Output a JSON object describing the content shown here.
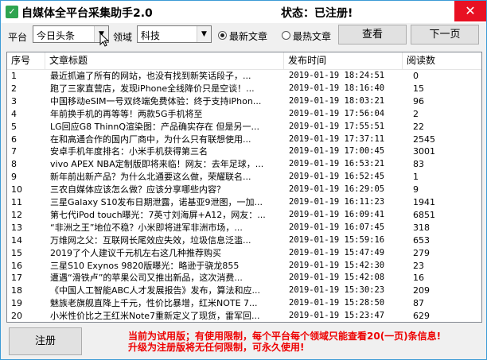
{
  "window": {
    "title": "自媒体全平台采集助手2.0",
    "status": "状态：已注册!",
    "icon": "app-logo-icon"
  },
  "toolbar": {
    "platform_label": "平台",
    "platform_value": "今日头条",
    "domain_label": "领域",
    "domain_value": "科技",
    "radio_latest": "最新文章",
    "radio_hottest": "最热文章",
    "selected_radio": "latest",
    "view_button": "查看",
    "next_button": "下一页"
  },
  "table": {
    "headers": {
      "no": "序号",
      "title": "文章标题",
      "date": "发布时间",
      "reads": "阅读数"
    },
    "rows": [
      {
        "no": "1",
        "title": "最近抓遍了所有的网站，也没有找到新笑话段子，...",
        "date": "2019-01-19 18:24:51",
        "reads": "0"
      },
      {
        "no": "2",
        "title": "跑了三家直营店，发现iPhone全线降价只是空谈！...",
        "date": "2019-01-19 18:16:40",
        "reads": "15"
      },
      {
        "no": "3",
        "title": "中国移动eSIM一号双终端免费体验：终于支持iPhon...",
        "date": "2019-01-19 18:03:21",
        "reads": "96"
      },
      {
        "no": "4",
        "title": "年前换手机的再等等！两款5G手机将至",
        "date": "2019-01-19 17:56:04",
        "reads": "2"
      },
      {
        "no": "5",
        "title": "LG回应G8 ThinnQ渲染图：产品确实存在 但是另一...",
        "date": "2019-01-19 17:55:51",
        "reads": "22"
      },
      {
        "no": "6",
        "title": "在和高通合作的国内厂商中，为什么只有联想使用...",
        "date": "2019-01-19 17:37:11",
        "reads": "2545"
      },
      {
        "no": "7",
        "title": "安卓手机年度排名：小米手机获得第三名",
        "date": "2019-01-19 17:00:45",
        "reads": "3001"
      },
      {
        "no": "8",
        "title": "vivo APEX NBA定制版即将来临！网友：去年足球，...",
        "date": "2019-01-19 16:53:21",
        "reads": "83"
      },
      {
        "no": "9",
        "title": "新年前出新产品？为什么北通要这么做，荣耀联名...",
        "date": "2019-01-19 16:52:45",
        "reads": "1"
      },
      {
        "no": "10",
        "title": "三农自媒体应该怎么做？应该分享哪些内容？",
        "date": "2019-01-19 16:29:05",
        "reads": "9"
      },
      {
        "no": "11",
        "title": "三星Galaxy S10发布日期泄露，诺基亚9泄图，一加...",
        "date": "2019-01-19 16:11:23",
        "reads": "1941"
      },
      {
        "no": "12",
        "title": "第七代iPod touch曝光：7英寸刘海屏+A12，网友：...",
        "date": "2019-01-19 16:09:41",
        "reads": "6851"
      },
      {
        "no": "13",
        "title": "“非洲之王”地位不稳？小米即将进军非洲市场，...",
        "date": "2019-01-19 16:07:45",
        "reads": "318"
      },
      {
        "no": "14",
        "title": "万维网之父：互联网长尾效应失效，垃圾信息泛滥...",
        "date": "2019-01-19 15:59:16",
        "reads": "653"
      },
      {
        "no": "15",
        "title": "2019了个人建议千元机左右这几种推荐购买",
        "date": "2019-01-19 15:47:49",
        "reads": "279"
      },
      {
        "no": "16",
        "title": "三星S10 Exynos 9820版曝光：略逊于骁龙855",
        "date": "2019-01-19 15:42:30",
        "reads": "23"
      },
      {
        "no": "17",
        "title": "遭遇“滑铁卢”的苹果公司又推出新品，这次消费...",
        "date": "2019-01-19 15:42:08",
        "reads": "16"
      },
      {
        "no": "18",
        "title": "《中国人工智能ABC人才发展报告》发布，算法和应...",
        "date": "2019-01-19 15:30:23",
        "reads": "209"
      },
      {
        "no": "19",
        "title": "魅族老旗舰直降上千元，性价比暴增，红米NOTE 7...",
        "date": "2019-01-19 15:28:50",
        "reads": "87"
      },
      {
        "no": "20",
        "title": "小米性价比之王红米Note7重新定义了现货，雷军回...",
        "date": "2019-01-19 15:23:47",
        "reads": "629"
      }
    ]
  },
  "bottom": {
    "register_button": "注册",
    "notice_line1": "当前为试用版；有使用限制，每个平台每个领域只能查看20(一页)条信息!",
    "notice_line2": "升级为注册版将无任何限制，可永久使用!"
  }
}
